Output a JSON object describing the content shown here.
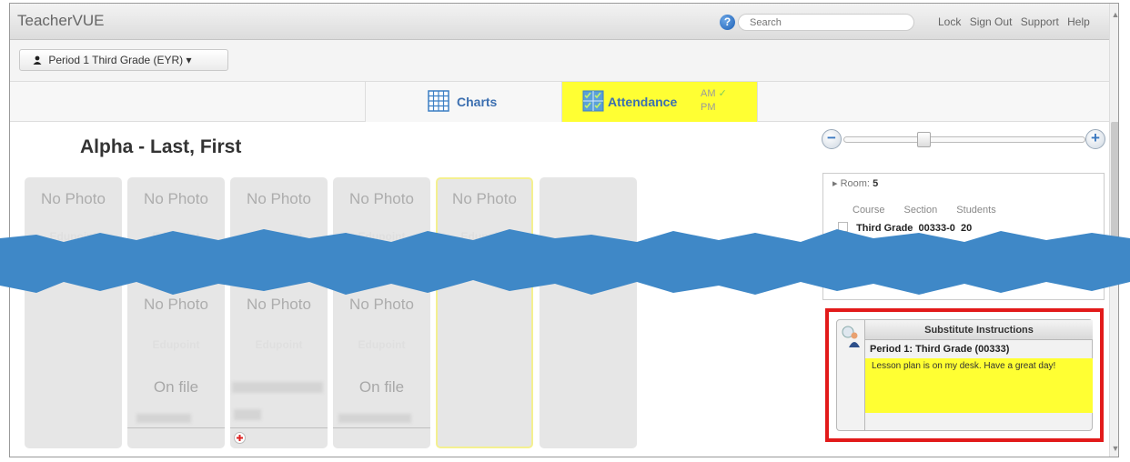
{
  "app": {
    "title": "TeacherVUE"
  },
  "topbar": {
    "help_symbol": "?",
    "search_placeholder": "Search",
    "links": [
      "Lock",
      "Sign Out",
      "Support",
      "Help"
    ]
  },
  "period_selector": {
    "label": "Period 1 Third Grade (EYR)",
    "caret": "▾"
  },
  "tabs": [
    {
      "label": "Charts",
      "icon": "grid-chart-icon",
      "active": false
    },
    {
      "label": "Attendance",
      "icon": "attendance-check-icon",
      "active": true,
      "am": "AM",
      "am_mark": "✓",
      "pm": "PM"
    }
  ],
  "seating": {
    "title": "Alpha - Last, First",
    "zoom": {
      "minus": "−",
      "plus": "+"
    },
    "no_photo_text": "No Photo",
    "logo_text": "Edupoint",
    "on_file_text": "On file",
    "add_symbol": "+"
  },
  "room_panel": {
    "room_label": "Room:",
    "room_value": "5",
    "headers": [
      "Course",
      "Section",
      "Students"
    ],
    "course": {
      "name": "Third Grade",
      "section": "00333-0",
      "students": "20"
    }
  },
  "substitute": {
    "title": "Substitute Instructions",
    "period": "Period 1: Third Grade (00333)",
    "note": "Lesson plan is on my desk. Have a great day!"
  },
  "scrollbar": {
    "up": "▲",
    "down": "▼"
  },
  "colors": {
    "attendance_tab": "#ffff33",
    "highlight_border": "#e21a1a",
    "torn_band": "#3f88c7"
  }
}
